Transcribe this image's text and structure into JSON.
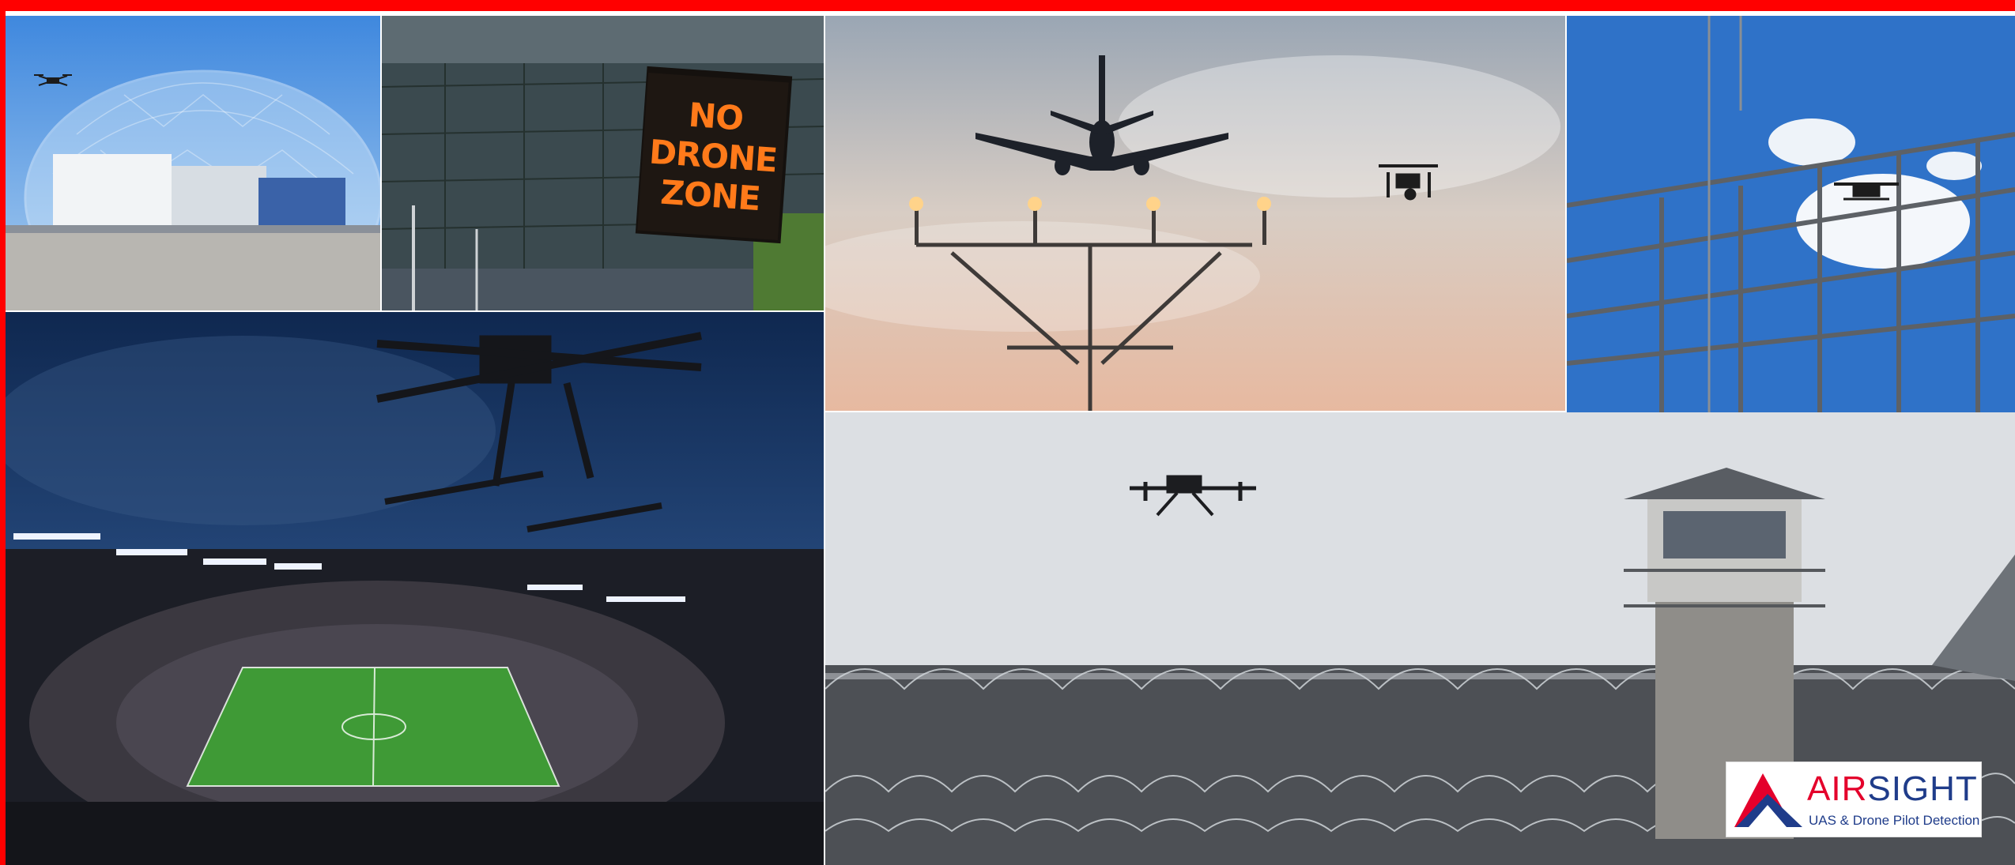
{
  "colors": {
    "frame": "#ff0000",
    "sign_text": "#ff7a1a",
    "sign_bg": "#1e1712",
    "brand_red": "#e4002b",
    "brand_blue": "#1f3c8a",
    "sky_blue": "#2f72c8",
    "night_blue": "#1a3866",
    "pitch_green": "#3f9a36",
    "dusk_sky": "#d9c3b0",
    "overcast": "#dcdfe3"
  },
  "scenes": [
    {
      "key": "dome",
      "subject": "drone near a domed facility"
    },
    {
      "key": "no_drone_sign",
      "subject": "stadium exterior with no drone zone sign"
    },
    {
      "key": "airport",
      "subject": "airliner and drone over runway approach lights"
    },
    {
      "key": "power",
      "subject": "drone over electrical substation"
    },
    {
      "key": "stadium",
      "subject": "drone over a night football stadium"
    },
    {
      "key": "prison",
      "subject": "drone near a prison guard tower and razor wire fence"
    }
  ],
  "sign": {
    "lines": [
      "NO",
      "DRONE",
      "ZONE"
    ]
  },
  "logo": {
    "name_part1": "AIR",
    "name_part2": "SIGHT",
    "tagline": "UAS & Drone Pilot Detection",
    "mark_icon": "airsight-mountain-logo-icon"
  },
  "icons": [
    "quadcopter-drone-icon",
    "airplane-icon",
    "guard-tower-icon"
  ]
}
